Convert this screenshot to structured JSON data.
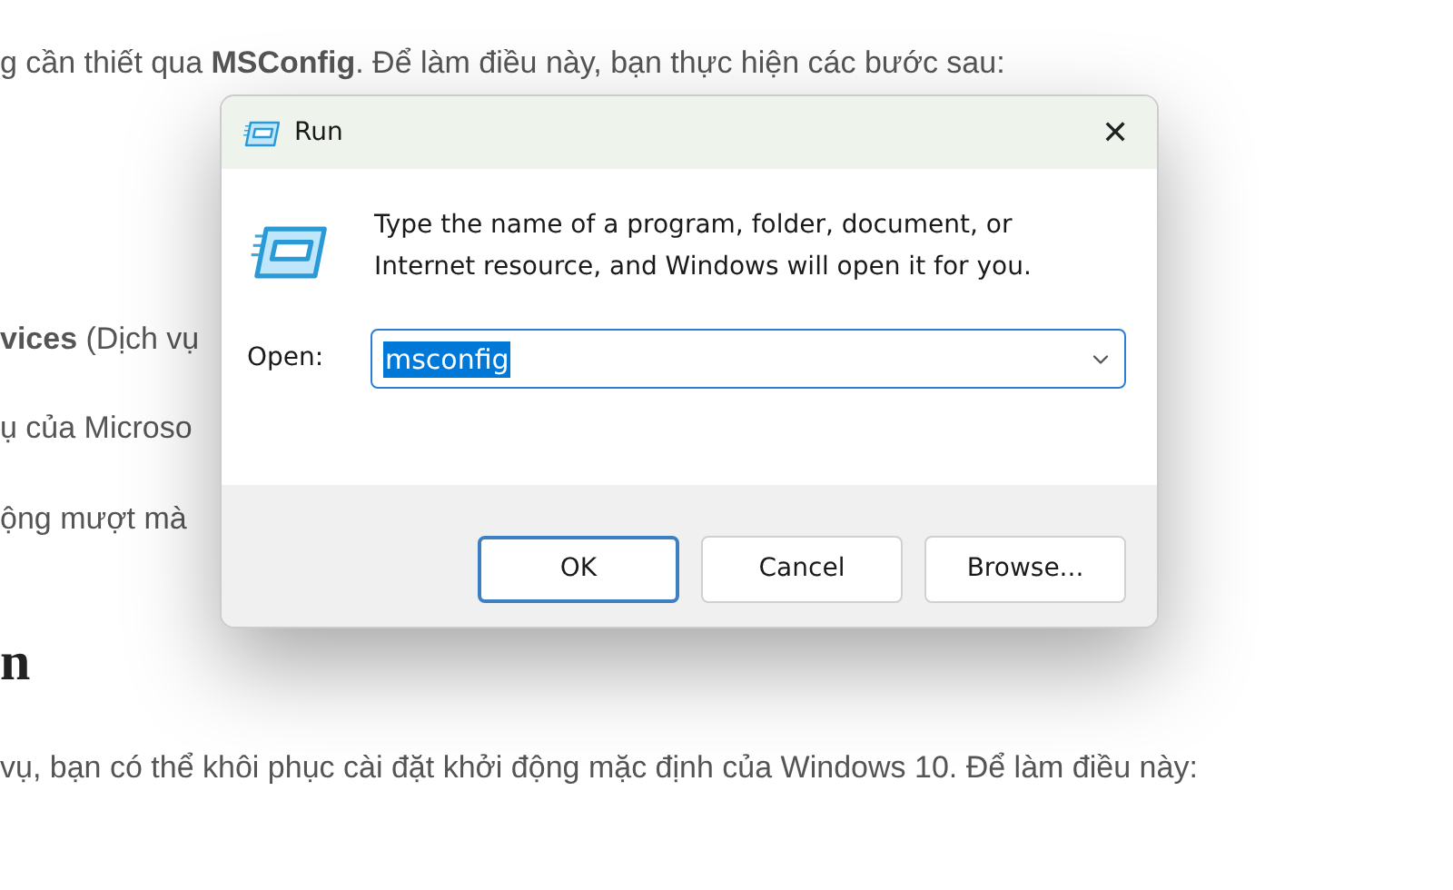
{
  "article": {
    "intro": "g cần thiết qua **MSConfig**. Để làm điều này, bạn thực hiện các bước sau:",
    "lines": [
      "**vices** (Dịch vụ",
      "ụ của Microso",
      "ộng mượt mà"
    ],
    "heading": "n",
    "paragraph": "vụ, bạn có thể khôi phục cài đặt khởi động mặc định của Windows 10. Để làm điều này:"
  },
  "dialog": {
    "title": "Run",
    "close": "✕",
    "message": "Type the name of a program, folder, document, or Internet resource, and Windows will open it for you.",
    "open_label": "Open:",
    "open_value": "msconfig",
    "buttons": [
      {
        "label": "OK",
        "selected": true
      },
      {
        "label": "Cancel",
        "selected": false
      },
      {
        "label": "Browse...",
        "selected": false
      }
    ]
  }
}
